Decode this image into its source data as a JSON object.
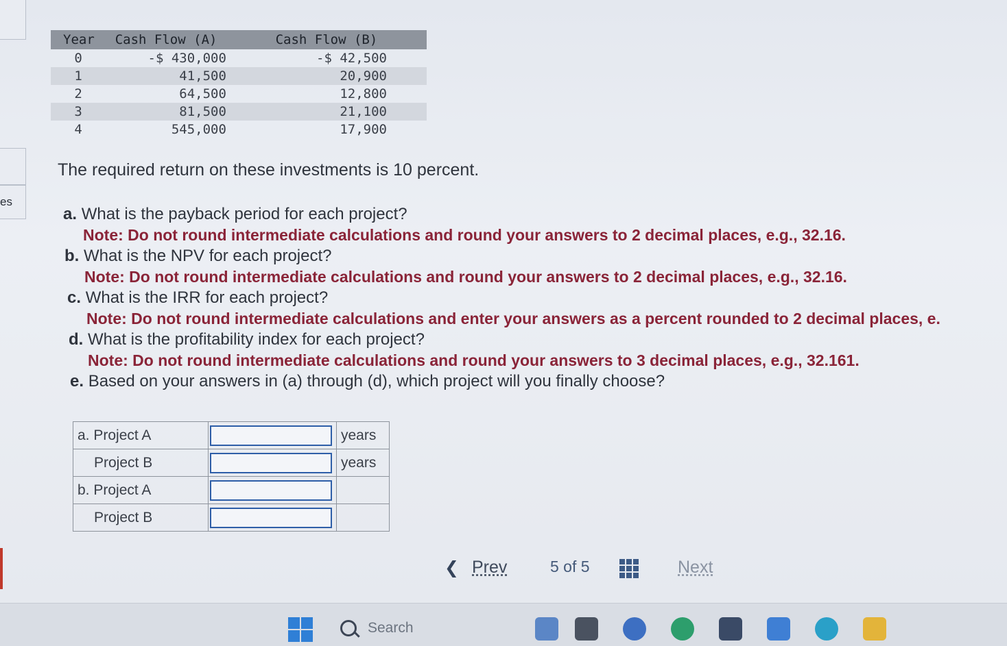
{
  "left_fragment": {
    "text": "es"
  },
  "cash_flow_table": {
    "headers": [
      "Year",
      "Cash Flow (A)",
      "Cash Flow (B)"
    ],
    "rows": [
      [
        "0",
        "-$ 430,000",
        "-$ 42,500"
      ],
      [
        "1",
        "41,500",
        "20,900"
      ],
      [
        "2",
        "64,500",
        "12,800"
      ],
      [
        "3",
        "81,500",
        "21,100"
      ],
      [
        "4",
        "545,000",
        "17,900"
      ]
    ]
  },
  "required_return": "The required return on these investments is 10 percent.",
  "questions": [
    {
      "letter": "a.",
      "text": "What is the payback period for each project?",
      "note": "Note: Do not round intermediate calculations and round your answers to 2 decimal places, e.g., 32.16."
    },
    {
      "letter": "b.",
      "text": "What is the NPV for each project?",
      "note": "Note: Do not round intermediate calculations and round your answers to 2 decimal places, e.g., 32.16."
    },
    {
      "letter": "c.",
      "text": "What is the IRR for each project?",
      "note": "Note: Do not round intermediate calculations and enter your answers as a percent rounded to 2 decimal places, e."
    },
    {
      "letter": "d.",
      "text": "What is the profitability index for each project?",
      "note": "Note: Do not round intermediate calculations and round your answers to 3 decimal places, e.g., 32.161."
    },
    {
      "letter": "e.",
      "text": "Based on your answers in (a) through (d), which project will you finally choose?",
      "note": ""
    }
  ],
  "answer_table": {
    "rows": [
      {
        "label": "a. Project A",
        "value": "",
        "unit": "years"
      },
      {
        "label": "Project B",
        "value": "",
        "unit": "years"
      },
      {
        "label": "b. Project A",
        "value": "",
        "unit": ""
      },
      {
        "label": "Project B",
        "value": "",
        "unit": ""
      }
    ]
  },
  "pagination": {
    "prev_label": "Prev",
    "page_text": "5 of 5",
    "next_label": "Next"
  },
  "taskbar": {
    "search_placeholder": "Search"
  },
  "colors": {
    "note_red": "#8a2438",
    "input_border": "#2e5ea8",
    "header_gray": "#8e949d"
  }
}
